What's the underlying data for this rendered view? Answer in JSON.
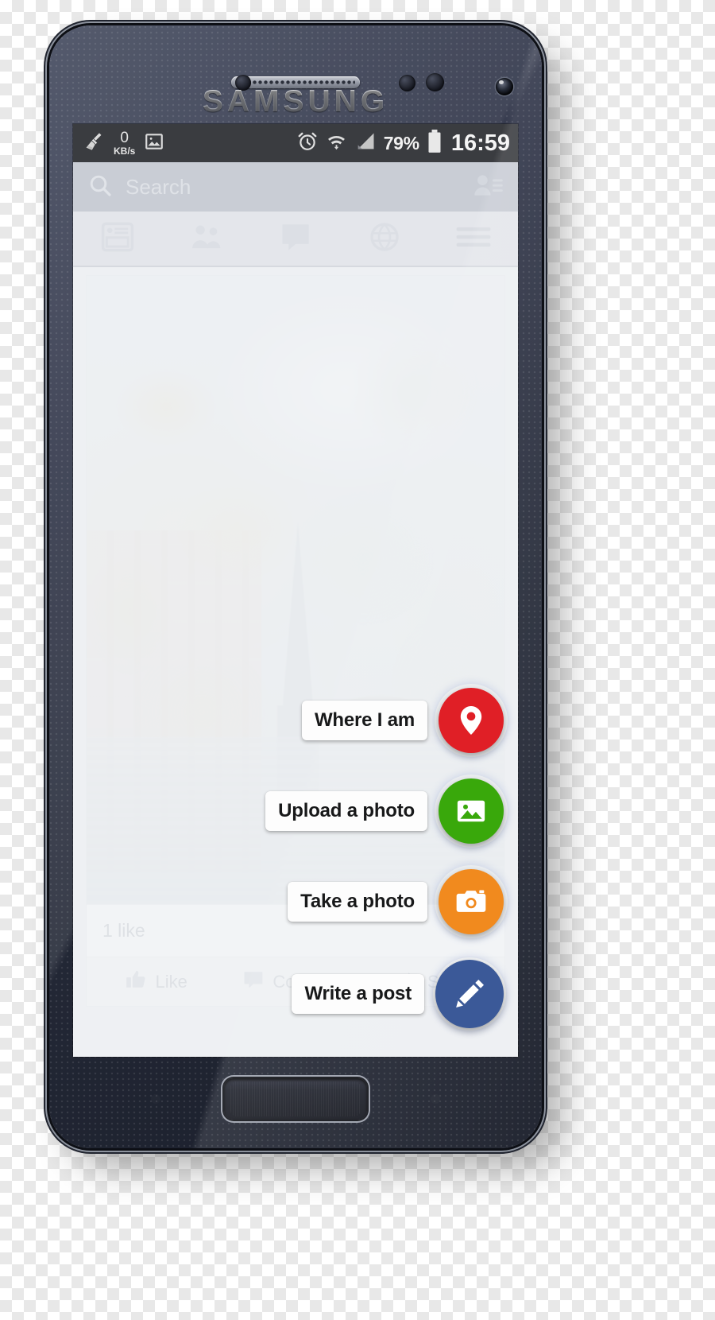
{
  "device": {
    "brand": "SAMSUNG",
    "hardware": {
      "earpiece": "earpiece-grille",
      "front_camera": "front-camera",
      "home_button": "home-button"
    }
  },
  "statusbar": {
    "clean_icon": "broom-icon",
    "network_speed": {
      "value": "0",
      "unit": "KB/s"
    },
    "gallery_icon": "image-icon",
    "alarm_icon": "alarm-clock-icon",
    "wifi_icon": "wifi-icon",
    "signal_icon": "cellular-signal-icon",
    "battery_percent": "79%",
    "battery_icon": "battery-icon",
    "clock": "16:59"
  },
  "app": {
    "search": {
      "placeholder": "Search",
      "icon": "search-icon",
      "friend_requests_icon": "friend-requests-icon"
    },
    "tabs": [
      {
        "name": "news-feed",
        "icon": "news-feed-icon"
      },
      {
        "name": "friend-requests",
        "icon": "people-icon"
      },
      {
        "name": "messages",
        "icon": "chat-bubble-icon"
      },
      {
        "name": "notifications",
        "icon": "globe-icon"
      },
      {
        "name": "more-menu",
        "icon": "hamburger-menu-icon"
      }
    ],
    "post": {
      "photo_alt": "town-with-church-spire-photo",
      "likes": "1 like",
      "actions": [
        {
          "label": "Like",
          "icon": "thumbs-up-icon"
        },
        {
          "label": "Comment",
          "icon": "comment-icon"
        },
        {
          "label": "Share",
          "icon": "share-arrow-icon"
        }
      ]
    },
    "fab_menu": [
      {
        "label": "Where I am",
        "icon": "location-pin-icon",
        "color": "#e01f26"
      },
      {
        "label": "Upload a photo",
        "icon": "photo-icon",
        "color": "#39a80b"
      },
      {
        "label": "Take a photo",
        "icon": "camera-icon",
        "color": "#f18a1e"
      },
      {
        "label": "Write a post",
        "icon": "pencil-icon",
        "color": "#3b5998"
      }
    ]
  },
  "colors": {
    "statusbar_bg": "#3a3c40",
    "search_bg": "#c9cdd5",
    "feed_bg": "#e9ebee",
    "fab_red": "#e01f26",
    "fab_green": "#39a80b",
    "fab_orange": "#f18a1e",
    "fab_blue": "#3b5998"
  }
}
